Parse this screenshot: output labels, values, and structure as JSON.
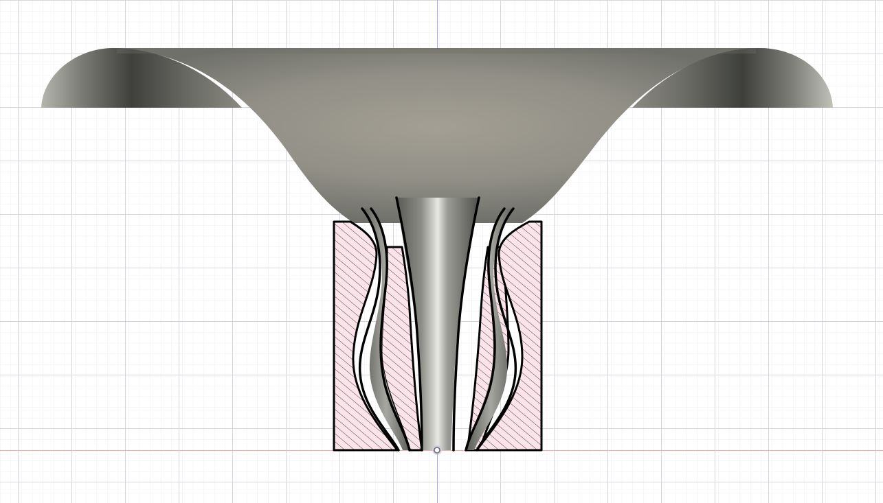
{
  "viewport": {
    "kind": "cad-canvas",
    "view": "front",
    "grid": true,
    "colors": {
      "background": "#ffffff",
      "grid_minor": "#ececf1",
      "grid_major": "#d6d6de",
      "axis_vertical": "#a9a9ee",
      "axis_horizontal": "#f2b0b0",
      "section_fill": "#fde4ea",
      "hatch": "#2b2b2b",
      "outline": "#000000",
      "body_light": "#a6a398",
      "body_mid": "#807e76",
      "body_dark": "#3e3f3b"
    }
  },
  "model": {
    "body": "trumpet-flare",
    "section_view": true,
    "section_cut_regions": 6,
    "origin_marker": true
  }
}
